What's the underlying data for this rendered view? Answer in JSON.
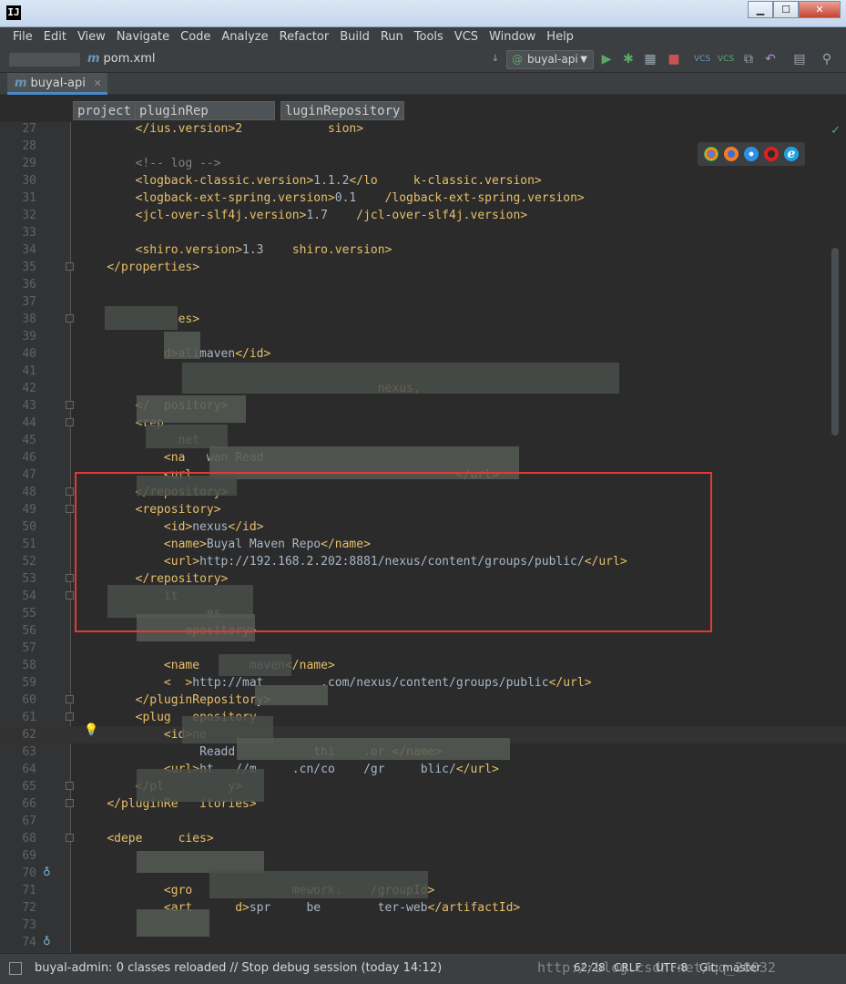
{
  "window": {
    "app_icon": "IJ",
    "minimize": "▁",
    "maximize": "☐",
    "close": "✕"
  },
  "menu": [
    "File",
    "Edit",
    "View",
    "Navigate",
    "Code",
    "Analyze",
    "Refactor",
    "Build",
    "Run",
    "Tools",
    "VCS",
    "Window",
    "Help"
  ],
  "navbar": {
    "file": "pom.xml",
    "run_config": "buyal-api"
  },
  "tab": {
    "label": "buyal-api"
  },
  "breadcrumbs": [
    "project",
    "pluginRep",
    "luginRepository"
  ],
  "editor": {
    "lines": [
      {
        "n": "27",
        "parts": [
          [
            "txt",
            "        "
          ],
          [
            "tag",
            "</"
          ],
          [
            "tag",
            "ius.version>2"
          ],
          [
            "tag",
            "            sion>"
          ]
        ]
      },
      {
        "n": "28",
        "parts": []
      },
      {
        "n": "29",
        "parts": [
          [
            "txt",
            "        "
          ],
          [
            "cmt",
            "<!-- log -->"
          ]
        ]
      },
      {
        "n": "30",
        "parts": [
          [
            "txt",
            "        "
          ],
          [
            "tag",
            "<logback-classic.version>"
          ],
          [
            "txt",
            "1.1.2"
          ],
          [
            "tag",
            "</lo     k-classic.version>"
          ]
        ]
      },
      {
        "n": "31",
        "parts": [
          [
            "txt",
            "        "
          ],
          [
            "tag",
            "<logback-ext-spring.version>"
          ],
          [
            "txt",
            "0.1    "
          ],
          [
            "tag",
            "/logback-ext-spring.version>"
          ]
        ]
      },
      {
        "n": "32",
        "parts": [
          [
            "txt",
            "        "
          ],
          [
            "tag",
            "<jcl-over-slf4j.version>"
          ],
          [
            "txt",
            "1.7    "
          ],
          [
            "tag",
            "/jcl-over-slf4j.version>"
          ]
        ]
      },
      {
        "n": "33",
        "parts": []
      },
      {
        "n": "34",
        "parts": [
          [
            "txt",
            "        "
          ],
          [
            "tag",
            "<shiro.version>"
          ],
          [
            "txt",
            "1.3    "
          ],
          [
            "tag",
            "shiro.version>"
          ]
        ]
      },
      {
        "n": "35",
        "parts": [
          [
            "txt",
            "    "
          ],
          [
            "tag",
            "</properties>"
          ]
        ]
      },
      {
        "n": "36",
        "parts": []
      },
      {
        "n": "37",
        "parts": []
      },
      {
        "n": "38",
        "parts": [
          [
            "txt",
            "          "
          ],
          [
            "tag",
            "    es>"
          ]
        ]
      },
      {
        "n": "39",
        "parts": []
      },
      {
        "n": "40",
        "parts": [
          [
            "txt",
            "            "
          ],
          [
            "tag",
            "d>"
          ],
          [
            "txt",
            "alimaven"
          ],
          [
            "tag",
            "</id>"
          ]
        ]
      },
      {
        "n": "41",
        "parts": []
      },
      {
        "n": "42",
        "parts": [
          [
            "txt",
            "                                          "
          ],
          [
            "tag",
            "nexus,"
          ]
        ]
      },
      {
        "n": "43",
        "parts": [
          [
            "txt",
            "        "
          ],
          [
            "tag",
            "</  pository>"
          ]
        ]
      },
      {
        "n": "44",
        "parts": [
          [
            "txt",
            "        "
          ],
          [
            "tag",
            "<rep"
          ]
        ]
      },
      {
        "n": "45",
        "parts": [
          [
            "txt",
            "            "
          ],
          [
            "txt",
            "  net"
          ]
        ]
      },
      {
        "n": "46",
        "parts": [
          [
            "txt",
            "            "
          ],
          [
            "tag",
            "<na   "
          ],
          [
            "txt",
            "wan Read"
          ]
        ]
      },
      {
        "n": "47",
        "parts": [
          [
            "txt",
            "            "
          ],
          [
            "tag",
            "<url"
          ],
          [
            "txt",
            "                                     "
          ],
          [
            "tag",
            "</url>"
          ]
        ]
      },
      {
        "n": "48",
        "parts": [
          [
            "txt",
            "        "
          ],
          [
            "tag",
            "</repository>"
          ]
        ]
      },
      {
        "n": "49",
        "parts": [
          [
            "txt",
            "        "
          ],
          [
            "tag",
            "<repository>"
          ]
        ]
      },
      {
        "n": "50",
        "parts": [
          [
            "txt",
            "            "
          ],
          [
            "tag",
            "<id>"
          ],
          [
            "txt",
            "nexus"
          ],
          [
            "tag",
            "</id>"
          ]
        ]
      },
      {
        "n": "51",
        "parts": [
          [
            "txt",
            "            "
          ],
          [
            "tag",
            "<name>"
          ],
          [
            "txt",
            "Buyal Maven Repo"
          ],
          [
            "tag",
            "</name>"
          ]
        ]
      },
      {
        "n": "52",
        "parts": [
          [
            "txt",
            "            "
          ],
          [
            "tag",
            "<url>"
          ],
          [
            "txt",
            "http://192.168.2.202:8881/nexus/content/groups/public/"
          ],
          [
            "tag",
            "</url>"
          ]
        ]
      },
      {
        "n": "53",
        "parts": [
          [
            "txt",
            "        "
          ],
          [
            "tag",
            "</repository>"
          ]
        ]
      },
      {
        "n": "54",
        "parts": [
          [
            "txt",
            "          "
          ],
          [
            "tag",
            "  it  "
          ]
        ]
      },
      {
        "n": "55",
        "parts": [
          [
            "txt",
            "                "
          ],
          [
            "tag",
            "  es"
          ]
        ]
      },
      {
        "n": "56",
        "parts": [
          [
            "txt",
            "            "
          ],
          [
            "tag",
            "   epository>"
          ]
        ]
      },
      {
        "n": "57",
        "parts": []
      },
      {
        "n": "58",
        "parts": [
          [
            "txt",
            "            "
          ],
          [
            "tag",
            "<name"
          ],
          [
            "txt",
            "       maven"
          ],
          [
            "tag",
            "</name>"
          ]
        ]
      },
      {
        "n": "59",
        "parts": [
          [
            "txt",
            "            "
          ],
          [
            "tag",
            "<  >"
          ],
          [
            "txt",
            "http://mat        .com/nexus/content/groups/public"
          ],
          [
            "tag",
            "</url>"
          ]
        ]
      },
      {
        "n": "60",
        "parts": [
          [
            "txt",
            "        "
          ],
          [
            "tag",
            "</pluginRepository>"
          ]
        ]
      },
      {
        "n": "61",
        "parts": [
          [
            "txt",
            "        "
          ],
          [
            "tag",
            "<plug   epository"
          ]
        ]
      },
      {
        "n": "62",
        "parts": [
          [
            "txt",
            "            "
          ],
          [
            "tag",
            "<id>"
          ],
          [
            "txt",
            "ne"
          ]
        ]
      },
      {
        "n": "63",
        "parts": [
          [
            "txt",
            "                 "
          ],
          [
            "txt",
            "Readd           thi    .or "
          ],
          [
            "tag",
            "</name>"
          ]
        ]
      },
      {
        "n": "64",
        "parts": [
          [
            "txt",
            "            "
          ],
          [
            "tag",
            "<url>"
          ],
          [
            "txt",
            "ht   //m     .cn/co    /gr     blic/"
          ],
          [
            "tag",
            "</url>"
          ]
        ]
      },
      {
        "n": "65",
        "parts": [
          [
            "txt",
            "        "
          ],
          [
            "tag",
            "</pl         y>"
          ]
        ]
      },
      {
        "n": "66",
        "parts": [
          [
            "txt",
            "    "
          ],
          [
            "tag",
            "</pluginRe   itories>"
          ]
        ]
      },
      {
        "n": "67",
        "parts": []
      },
      {
        "n": "68",
        "parts": [
          [
            "txt",
            "    "
          ],
          [
            "tag",
            "<depe     cies>"
          ]
        ]
      },
      {
        "n": "69",
        "parts": []
      },
      {
        "n": "70",
        "parts": []
      },
      {
        "n": "71",
        "parts": [
          [
            "txt",
            "            "
          ],
          [
            "tag",
            "<gro"
          ],
          [
            "txt",
            "              mework."
          ],
          [
            "tag",
            "    /groupId>"
          ]
        ]
      },
      {
        "n": "72",
        "parts": [
          [
            "txt",
            "            "
          ],
          [
            "tag",
            "<art      d>"
          ],
          [
            "txt",
            "spr     be        ter-web"
          ],
          [
            "tag",
            "</artifactId>"
          ]
        ]
      },
      {
        "n": "73",
        "parts": []
      },
      {
        "n": "74",
        "parts": []
      }
    ]
  },
  "status": {
    "message": "buyal-admin: 0 classes reloaded // Stop debug session (today 14:12)",
    "position": "62:28",
    "line_sep": "CRLF",
    "encoding": "UTF-8",
    "git": "Git: master",
    "watermark": "http://blog.csdn.net/qq_20032"
  }
}
